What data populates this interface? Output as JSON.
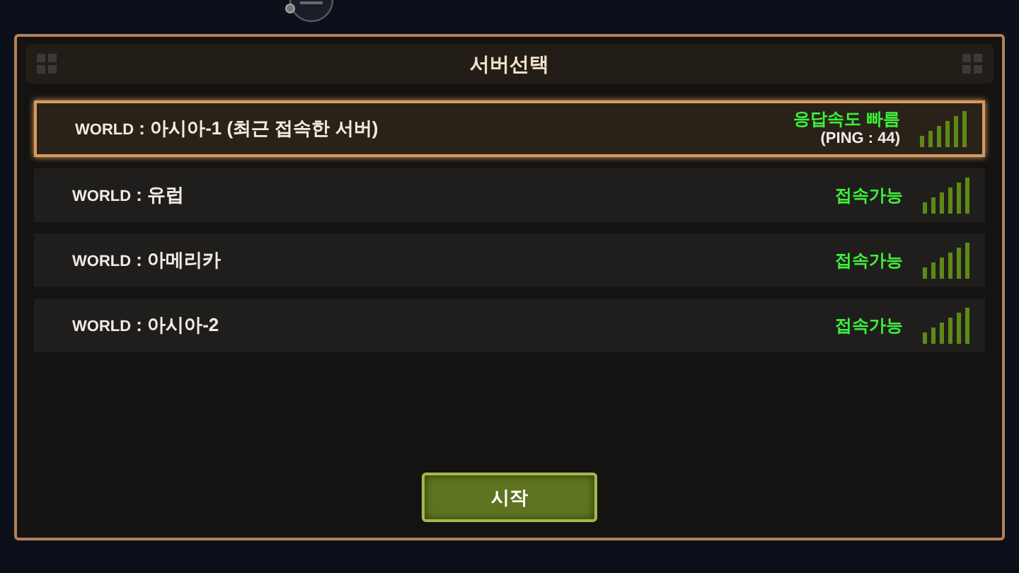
{
  "dialog": {
    "title": "서버선택"
  },
  "servers": [
    {
      "prefix": "WORLD",
      "separator": ":",
      "name": "아시아-1 (최근 접속한 서버)",
      "status": "응답속도 빠름",
      "ping": "(PING : 44)",
      "selected": true
    },
    {
      "prefix": "WORLD",
      "separator": ":",
      "name": "유럽",
      "status": "접속가능",
      "selected": false
    },
    {
      "prefix": "WORLD",
      "separator": ":",
      "name": "아메리카",
      "status": "접속가능",
      "selected": false
    },
    {
      "prefix": "WORLD",
      "separator": ":",
      "name": "아시아-2",
      "status": "접속가능",
      "selected": false
    }
  ],
  "start_button": "시작"
}
